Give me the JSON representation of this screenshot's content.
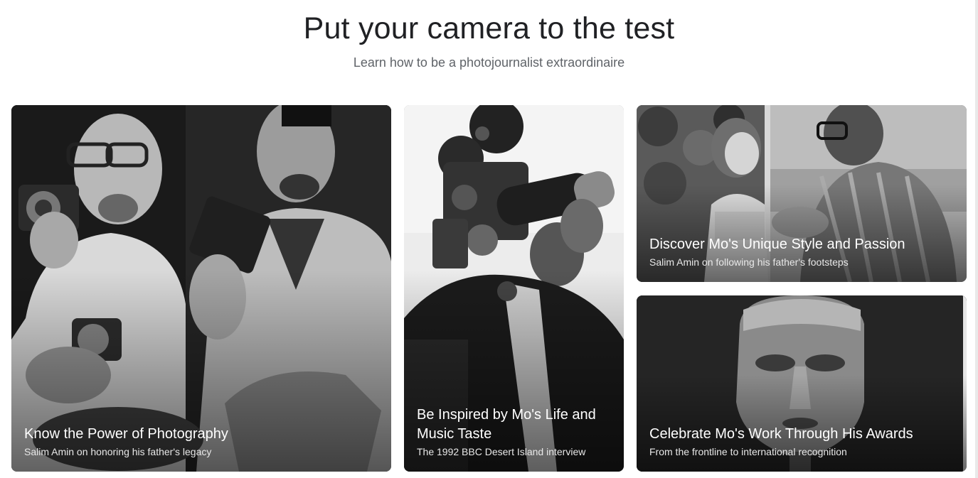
{
  "header": {
    "title": "Put your camera to the test",
    "subtitle": "Learn how to be a photojournalist extraordinaire"
  },
  "cards": [
    {
      "title": "Know the Power of Photography",
      "subtitle": "Salim Amin on honoring his father's legacy"
    },
    {
      "title": "Be Inspired by Mo's Life and Music Taste",
      "subtitle": "The 1992 BBC Desert Island interview"
    },
    {
      "title": "Discover Mo's Unique Style and Passion",
      "subtitle": "Salim Amin on following his father's footsteps"
    },
    {
      "title": "Celebrate Mo's Work Through His Awards",
      "subtitle": "From the frontline to international recognition"
    }
  ]
}
